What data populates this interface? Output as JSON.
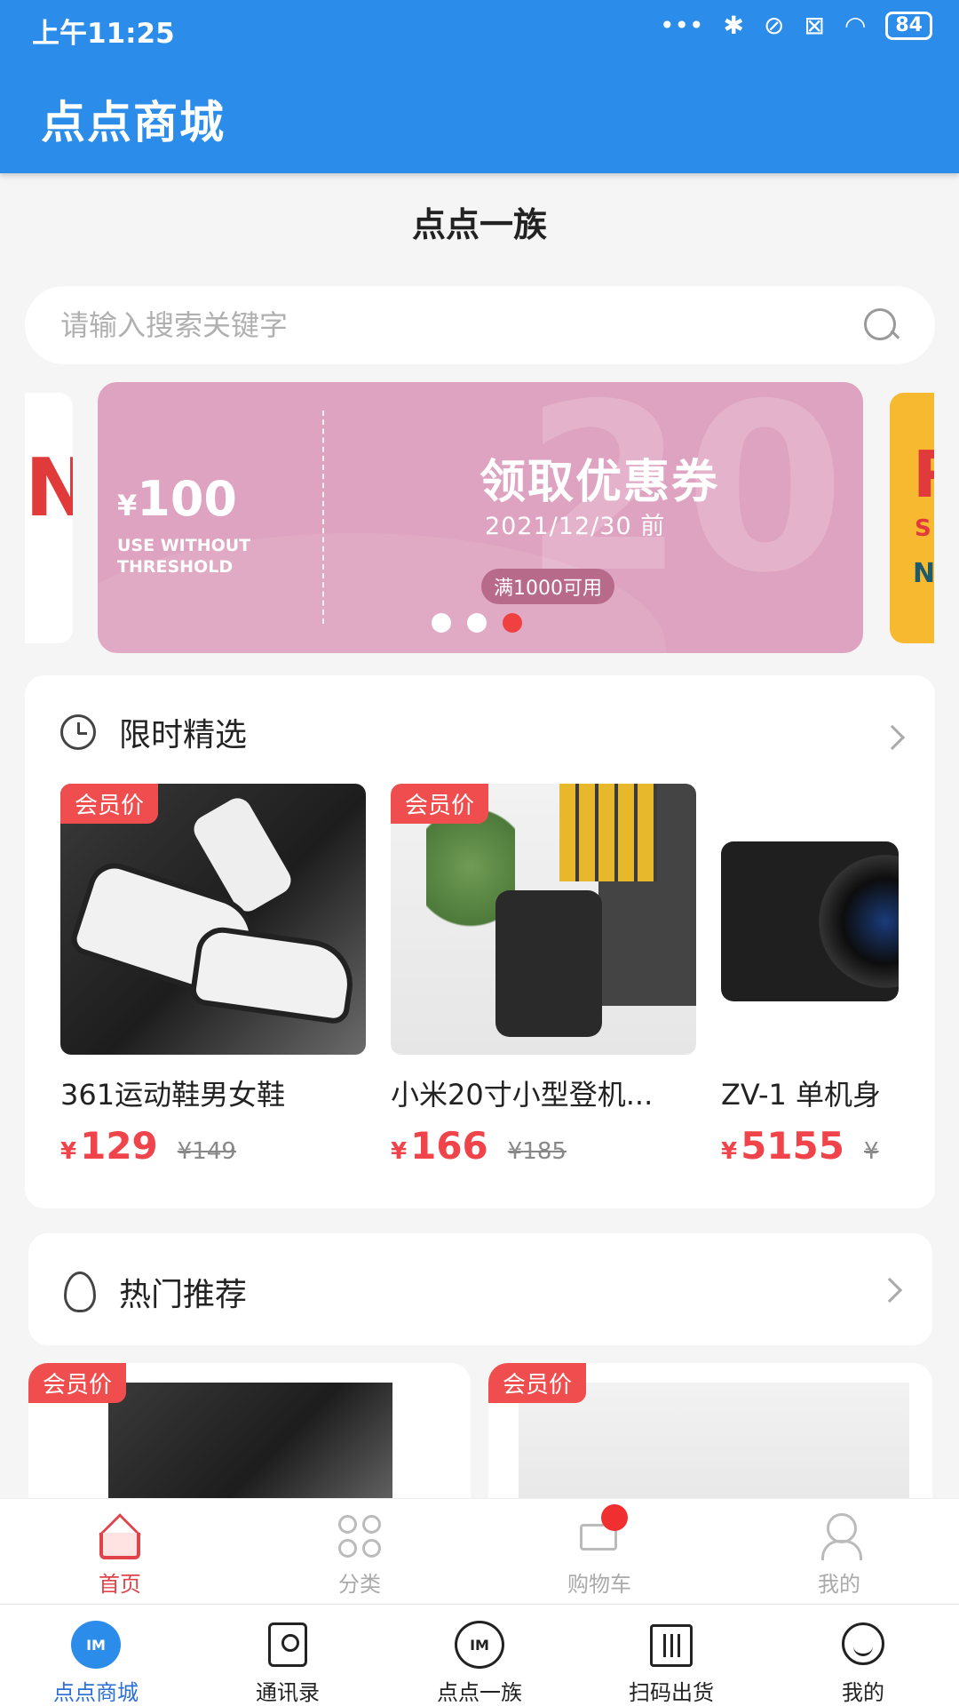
{
  "status_bar": {
    "time": "上午11:25",
    "battery": "84"
  },
  "app_bar": {
    "title": "点点商城"
  },
  "page": {
    "title": "点点一族"
  },
  "search": {
    "placeholder": "请输入搜索关键字"
  },
  "banner": {
    "currency": "¥",
    "amount": "100",
    "subtext": "USE WITHOUT THRESHOLD",
    "title": "领取优惠券",
    "date": "2021/12/30 前",
    "badge": "满1000可用",
    "watermark": "20",
    "dots_total": 3,
    "active_dot_index": 2,
    "left_peek_letter": "N",
    "right_peek": {
      "letter": "R",
      "s": "S",
      "n": "N"
    }
  },
  "flash_sale": {
    "title": "限时精选",
    "items": [
      {
        "badge": "会员价",
        "name": "361运动鞋男女鞋",
        "currency": "¥",
        "price": "129",
        "original": "¥149"
      },
      {
        "badge": "会员价",
        "name": "小米20寸小型登机...",
        "currency": "¥",
        "price": "166",
        "original": "¥185"
      },
      {
        "badge": "",
        "name": "ZV-1 单机身",
        "currency": "¥",
        "price": "5155",
        "original": "¥"
      }
    ]
  },
  "hot": {
    "title": "热门推荐",
    "items": [
      {
        "badge": "会员价"
      },
      {
        "badge": "会员价"
      }
    ]
  },
  "inner_tabs": [
    {
      "label": "首页",
      "active": true
    },
    {
      "label": "分类",
      "active": false
    },
    {
      "label": "购物车",
      "active": false
    },
    {
      "label": "我的",
      "active": false
    }
  ],
  "outer_tabs": [
    {
      "label": "点点商城",
      "active": true
    },
    {
      "label": "通讯录",
      "active": false
    },
    {
      "label": "点点一族",
      "active": false
    },
    {
      "label": "扫码出货",
      "active": false
    },
    {
      "label": "我的",
      "active": false
    }
  ],
  "im_icon_text": "IM",
  "colors": {
    "primary": "#2b8de9",
    "accent": "#f0444a",
    "banner": "#dea3c0"
  }
}
